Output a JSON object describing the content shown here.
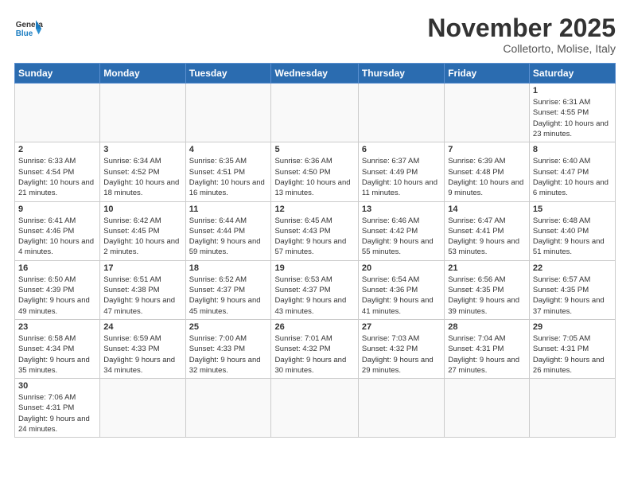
{
  "header": {
    "logo_general": "General",
    "logo_blue": "Blue",
    "month_title": "November 2025",
    "subtitle": "Colletorto, Molise, Italy"
  },
  "weekdays": [
    "Sunday",
    "Monday",
    "Tuesday",
    "Wednesday",
    "Thursday",
    "Friday",
    "Saturday"
  ],
  "weeks": [
    [
      {
        "day": "",
        "info": ""
      },
      {
        "day": "",
        "info": ""
      },
      {
        "day": "",
        "info": ""
      },
      {
        "day": "",
        "info": ""
      },
      {
        "day": "",
        "info": ""
      },
      {
        "day": "",
        "info": ""
      },
      {
        "day": "1",
        "info": "Sunrise: 6:31 AM\nSunset: 4:55 PM\nDaylight: 10 hours and 23 minutes."
      }
    ],
    [
      {
        "day": "2",
        "info": "Sunrise: 6:33 AM\nSunset: 4:54 PM\nDaylight: 10 hours and 21 minutes."
      },
      {
        "day": "3",
        "info": "Sunrise: 6:34 AM\nSunset: 4:52 PM\nDaylight: 10 hours and 18 minutes."
      },
      {
        "day": "4",
        "info": "Sunrise: 6:35 AM\nSunset: 4:51 PM\nDaylight: 10 hours and 16 minutes."
      },
      {
        "day": "5",
        "info": "Sunrise: 6:36 AM\nSunset: 4:50 PM\nDaylight: 10 hours and 13 minutes."
      },
      {
        "day": "6",
        "info": "Sunrise: 6:37 AM\nSunset: 4:49 PM\nDaylight: 10 hours and 11 minutes."
      },
      {
        "day": "7",
        "info": "Sunrise: 6:39 AM\nSunset: 4:48 PM\nDaylight: 10 hours and 9 minutes."
      },
      {
        "day": "8",
        "info": "Sunrise: 6:40 AM\nSunset: 4:47 PM\nDaylight: 10 hours and 6 minutes."
      }
    ],
    [
      {
        "day": "9",
        "info": "Sunrise: 6:41 AM\nSunset: 4:46 PM\nDaylight: 10 hours and 4 minutes."
      },
      {
        "day": "10",
        "info": "Sunrise: 6:42 AM\nSunset: 4:45 PM\nDaylight: 10 hours and 2 minutes."
      },
      {
        "day": "11",
        "info": "Sunrise: 6:44 AM\nSunset: 4:44 PM\nDaylight: 9 hours and 59 minutes."
      },
      {
        "day": "12",
        "info": "Sunrise: 6:45 AM\nSunset: 4:43 PM\nDaylight: 9 hours and 57 minutes."
      },
      {
        "day": "13",
        "info": "Sunrise: 6:46 AM\nSunset: 4:42 PM\nDaylight: 9 hours and 55 minutes."
      },
      {
        "day": "14",
        "info": "Sunrise: 6:47 AM\nSunset: 4:41 PM\nDaylight: 9 hours and 53 minutes."
      },
      {
        "day": "15",
        "info": "Sunrise: 6:48 AM\nSunset: 4:40 PM\nDaylight: 9 hours and 51 minutes."
      }
    ],
    [
      {
        "day": "16",
        "info": "Sunrise: 6:50 AM\nSunset: 4:39 PM\nDaylight: 9 hours and 49 minutes."
      },
      {
        "day": "17",
        "info": "Sunrise: 6:51 AM\nSunset: 4:38 PM\nDaylight: 9 hours and 47 minutes."
      },
      {
        "day": "18",
        "info": "Sunrise: 6:52 AM\nSunset: 4:37 PM\nDaylight: 9 hours and 45 minutes."
      },
      {
        "day": "19",
        "info": "Sunrise: 6:53 AM\nSunset: 4:37 PM\nDaylight: 9 hours and 43 minutes."
      },
      {
        "day": "20",
        "info": "Sunrise: 6:54 AM\nSunset: 4:36 PM\nDaylight: 9 hours and 41 minutes."
      },
      {
        "day": "21",
        "info": "Sunrise: 6:56 AM\nSunset: 4:35 PM\nDaylight: 9 hours and 39 minutes."
      },
      {
        "day": "22",
        "info": "Sunrise: 6:57 AM\nSunset: 4:35 PM\nDaylight: 9 hours and 37 minutes."
      }
    ],
    [
      {
        "day": "23",
        "info": "Sunrise: 6:58 AM\nSunset: 4:34 PM\nDaylight: 9 hours and 35 minutes."
      },
      {
        "day": "24",
        "info": "Sunrise: 6:59 AM\nSunset: 4:33 PM\nDaylight: 9 hours and 34 minutes."
      },
      {
        "day": "25",
        "info": "Sunrise: 7:00 AM\nSunset: 4:33 PM\nDaylight: 9 hours and 32 minutes."
      },
      {
        "day": "26",
        "info": "Sunrise: 7:01 AM\nSunset: 4:32 PM\nDaylight: 9 hours and 30 minutes."
      },
      {
        "day": "27",
        "info": "Sunrise: 7:03 AM\nSunset: 4:32 PM\nDaylight: 9 hours and 29 minutes."
      },
      {
        "day": "28",
        "info": "Sunrise: 7:04 AM\nSunset: 4:31 PM\nDaylight: 9 hours and 27 minutes."
      },
      {
        "day": "29",
        "info": "Sunrise: 7:05 AM\nSunset: 4:31 PM\nDaylight: 9 hours and 26 minutes."
      }
    ],
    [
      {
        "day": "30",
        "info": "Sunrise: 7:06 AM\nSunset: 4:31 PM\nDaylight: 9 hours and 24 minutes."
      },
      {
        "day": "",
        "info": ""
      },
      {
        "day": "",
        "info": ""
      },
      {
        "day": "",
        "info": ""
      },
      {
        "day": "",
        "info": ""
      },
      {
        "day": "",
        "info": ""
      },
      {
        "day": "",
        "info": ""
      }
    ]
  ]
}
